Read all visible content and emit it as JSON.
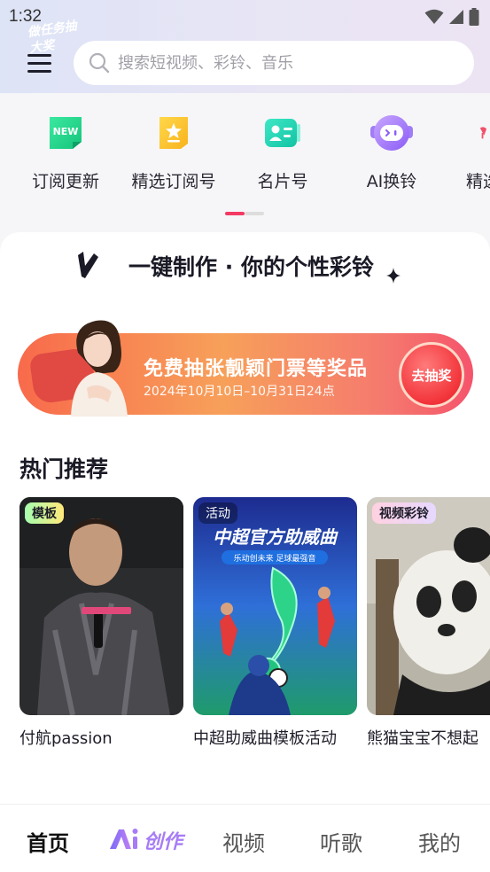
{
  "status_bar": {
    "time": "1:32"
  },
  "search": {
    "placeholder": "搜索短视频、彩铃、音乐"
  },
  "shortcuts": [
    {
      "label": "订阅更新",
      "icon": "new-badge-icon",
      "badge_text": "NEW"
    },
    {
      "label": "精选订阅号",
      "icon": "star-bookmark-icon"
    },
    {
      "label": "名片号",
      "icon": "contact-card-icon"
    },
    {
      "label": "AI换铃",
      "icon": "ai-robot-icon"
    },
    {
      "label": "精选",
      "icon": "partial-icon"
    }
  ],
  "slogan": "一键制作 · 你的个性彩铃",
  "banner": {
    "badge": "做任务抽大奖",
    "title": "免费抽张靓颖门票等奖品",
    "date": "2024年10月10日–10月31日24点",
    "button": "去抽奖"
  },
  "hot": {
    "title": "热门推荐",
    "items": [
      {
        "tag": "模板",
        "caption": "付航passion"
      },
      {
        "tag": "活动",
        "caption": "中超助威曲模板活动",
        "poster_title": "中超官方助威曲",
        "poster_sub": "乐动创未来 足球最强音"
      },
      {
        "tag": "视频彩铃",
        "caption": "熊猫宝宝不想起"
      }
    ]
  },
  "nav": {
    "home": "首页",
    "ai": "创作",
    "video": "视频",
    "music": "听歌",
    "mine": "我的"
  },
  "colors": {
    "accent_pink": "#f23a62",
    "banner_orange": "#f7a05a",
    "ai_purple": "#8b5cf6"
  }
}
